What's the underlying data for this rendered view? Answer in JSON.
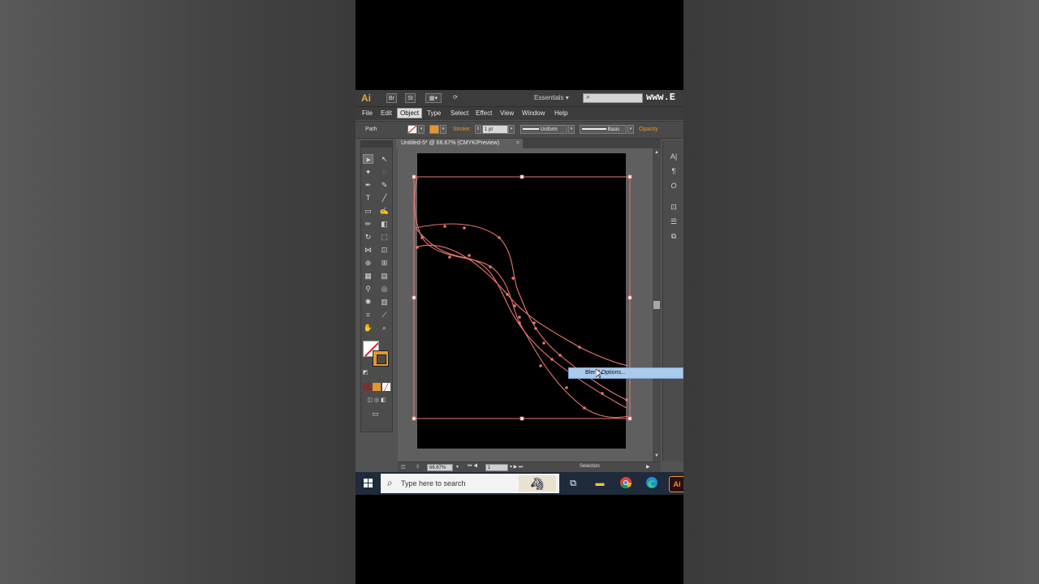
{
  "app": {
    "logo": "Ai",
    "title_buttons": [
      "Br",
      "St"
    ],
    "workspace": "Essentials",
    "watermark": "www.E"
  },
  "menu": [
    "File",
    "Edit",
    "Object",
    "Type",
    "Select",
    "Effect",
    "View",
    "Window",
    "Help"
  ],
  "menu_active": "Object",
  "control": {
    "selection_type": "Path",
    "stroke_label": "Stroke:",
    "stroke_weight": "1 pt",
    "profile": "Uniform",
    "brush": "Basic",
    "opacity_label": "Opacity"
  },
  "document": {
    "tab_title": "Untitled-5* @ 66.67% (CMYK/Preview)",
    "close": "×"
  },
  "context_menu": {
    "item": "Blend Options..."
  },
  "status": {
    "zoom": "66.67%",
    "artboard": "1",
    "tool": "Selection"
  },
  "taskbar": {
    "search_placeholder": "Type here to search",
    "apps": [
      "task-view",
      "file-explorer",
      "chrome",
      "edge",
      "illustrator"
    ],
    "ai_label": "Ai"
  },
  "colors": {
    "path_stroke": "#e8776f",
    "accent_orange": "#e8952b",
    "artboard": "#000000",
    "menu_highlight": "#a9cbec"
  }
}
